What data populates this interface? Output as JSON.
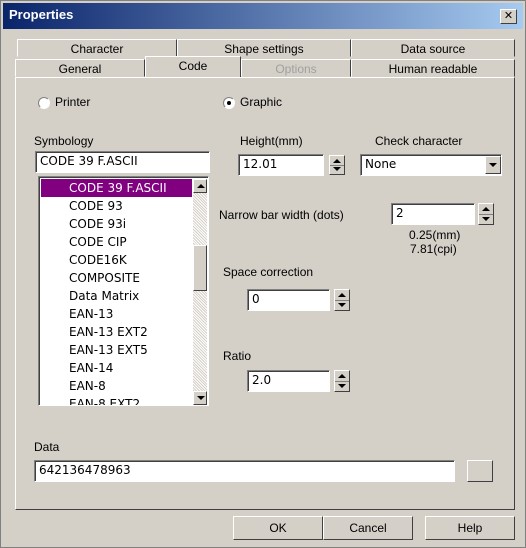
{
  "window": {
    "title": "Properties",
    "close_glyph": "✕"
  },
  "tabs_row1": [
    "Character",
    "Shape settings",
    "Data source"
  ],
  "tabs_row2": [
    {
      "label": "General",
      "state": "normal"
    },
    {
      "label": "Code",
      "state": "active"
    },
    {
      "label": "Options",
      "state": "disabled"
    },
    {
      "label": "Human readable",
      "state": "normal"
    }
  ],
  "mode": {
    "printer_label": "Printer",
    "graphic_label": "Graphic",
    "selected": "Graphic"
  },
  "symbology": {
    "label": "Symbology",
    "value": "CODE 39 F.ASCII",
    "items": [
      "CODE 39 F.ASCII",
      "CODE 93",
      "CODE 93i",
      "CODE CIP",
      "CODE16K",
      "COMPOSITE",
      "Data Matrix",
      "EAN-13",
      "EAN-13 EXT2",
      "EAN-13 EXT5",
      "EAN-14",
      "EAN-8",
      "EAN-8 EXT2"
    ],
    "selected_index": 0
  },
  "height": {
    "label": "Height(mm)",
    "value": "12.01"
  },
  "check_character": {
    "label": "Check character",
    "value": "None"
  },
  "narrow_bar": {
    "label": "Narrow bar width (dots)",
    "value": "2",
    "mm": "0.25(mm)",
    "cpi": "7.81(cpi)"
  },
  "space_correction": {
    "label": "Space correction",
    "value": "0"
  },
  "ratio": {
    "label": "Ratio",
    "value": "2.0"
  },
  "data": {
    "label": "Data",
    "value": "642136478963"
  },
  "buttons": {
    "ok": "OK",
    "cancel": "Cancel",
    "help": "Help"
  },
  "colors": {
    "face": "#d4d0c8",
    "title_start": "#0a246a",
    "selection": "#800080"
  }
}
